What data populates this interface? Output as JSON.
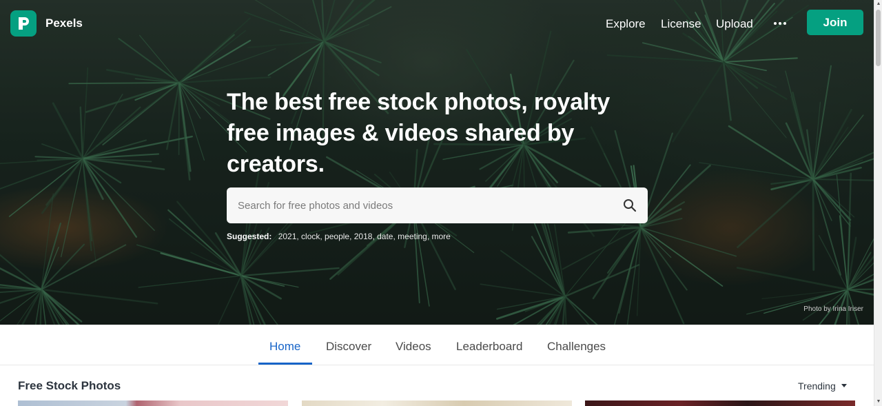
{
  "brand": {
    "name": "Pexels",
    "accent": "#05a081"
  },
  "nav": {
    "links": [
      "Explore",
      "License",
      "Upload"
    ],
    "more_icon": "more-horizontal-icon",
    "join_label": "Join"
  },
  "hero": {
    "headline": "The best free stock photos, royalty free images & videos shared by creators.",
    "search": {
      "placeholder": "Search for free photos and videos",
      "value": "",
      "icon": "search-icon"
    },
    "suggested_label": "Suggested:",
    "suggested_tags": "2021, clock, people, 2018, date, meeting, more",
    "credit": "Photo by Irina Iriser"
  },
  "tabs": [
    {
      "label": "Home",
      "active": true
    },
    {
      "label": "Discover",
      "active": false
    },
    {
      "label": "Videos",
      "active": false
    },
    {
      "label": "Leaderboard",
      "active": false
    },
    {
      "label": "Challenges",
      "active": false
    }
  ],
  "content": {
    "section_title": "Free Stock Photos",
    "sort_label": "Trending"
  },
  "colors": {
    "active_tab": "#1764c8",
    "text_dark": "#2c343e"
  }
}
